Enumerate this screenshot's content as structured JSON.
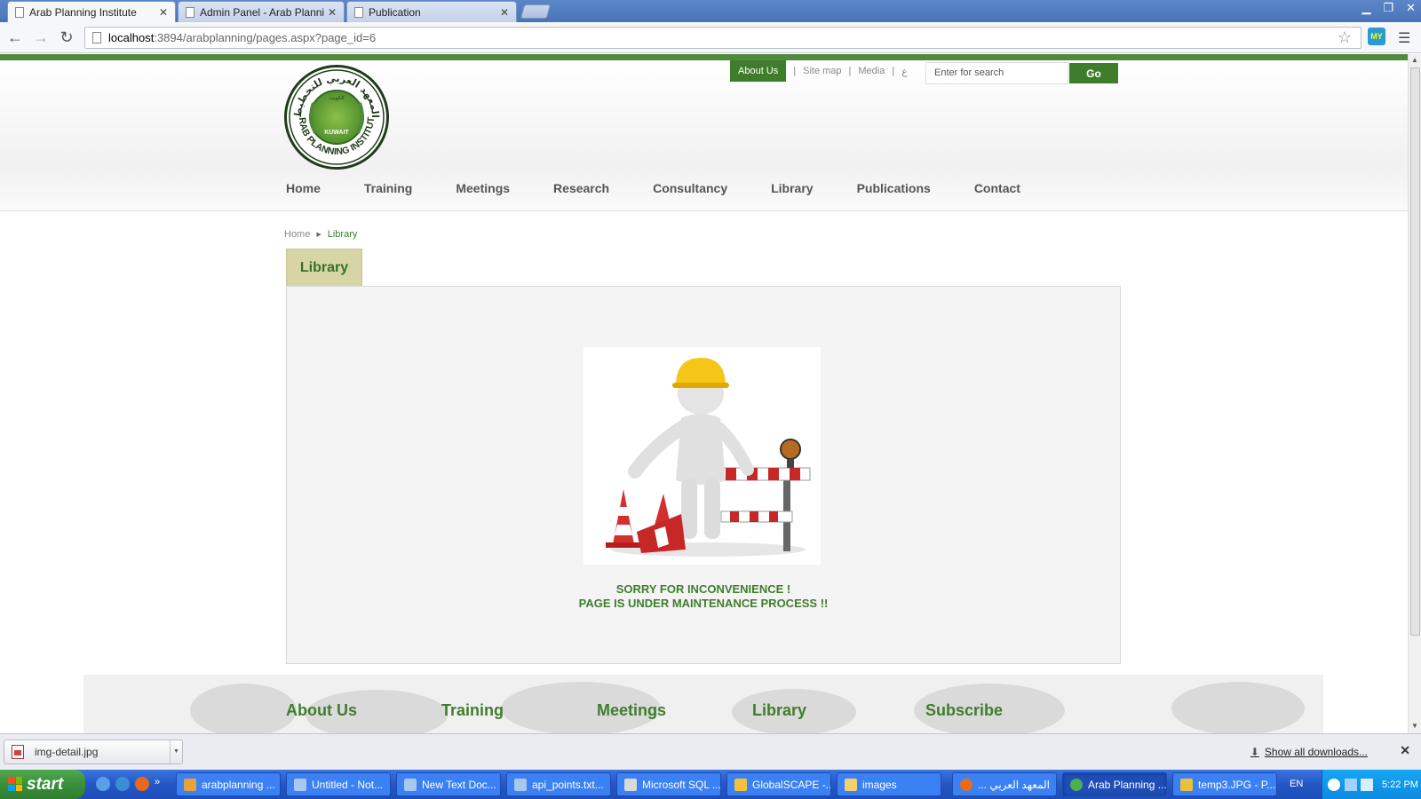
{
  "browser": {
    "tabs": [
      {
        "label": "Arab Planning Institute",
        "active": true
      },
      {
        "label": "Admin Panel - Arab Planning",
        "active": false
      },
      {
        "label": "Publication",
        "active": false
      }
    ],
    "url_host": "localhost",
    "url_path": ":3894/arabplanning/pages.aspx?page_id=6",
    "extension_label": "MY"
  },
  "site": {
    "logo_text": "ARAB PLANNING INSTITUTE",
    "logo_country": "KUWAIT",
    "logo_arabic": "المعهد العربي للتخطيط",
    "logo_arabic_city": "الكويت",
    "topnav": {
      "about": "About Us",
      "sitemap": "Site map",
      "media": "Media",
      "arabic": "ع"
    },
    "search": {
      "placeholder": "Enter for search",
      "button": "Go"
    },
    "mainnav": [
      "Home",
      "Training",
      "Meetings",
      "Research",
      "Consultancy",
      "Library",
      "Publications",
      "Contact"
    ],
    "breadcrumb": {
      "home": "Home",
      "current": "Library"
    },
    "page_title": "Library",
    "message_line1": "SORRY FOR INCONVENIENCE !",
    "message_line2": "PAGE IS UNDER MAINTENANCE PROCESS !!",
    "footer_columns": [
      "About Us",
      "Training",
      "Meetings",
      "Library",
      "Subscribe"
    ]
  },
  "downloads": {
    "file": "img-detail.jpg",
    "show_all": "Show all downloads..."
  },
  "taskbar": {
    "start": "start",
    "items": [
      "arabplanning ...",
      "Untitled - Not...",
      "New Text Doc...",
      "api_points.txt...",
      "Microsoft SQL ...",
      "GlobalSCAPE -...",
      "images",
      "... المعهد العربي",
      "Arab Planning ...",
      "temp3.JPG - P..."
    ],
    "language": "EN",
    "clock": "5:22 PM"
  },
  "colors": {
    "brand_green": "#3f7d2c",
    "tab_beige": "#d7d5a6",
    "xp_blue": "#2457c5"
  }
}
